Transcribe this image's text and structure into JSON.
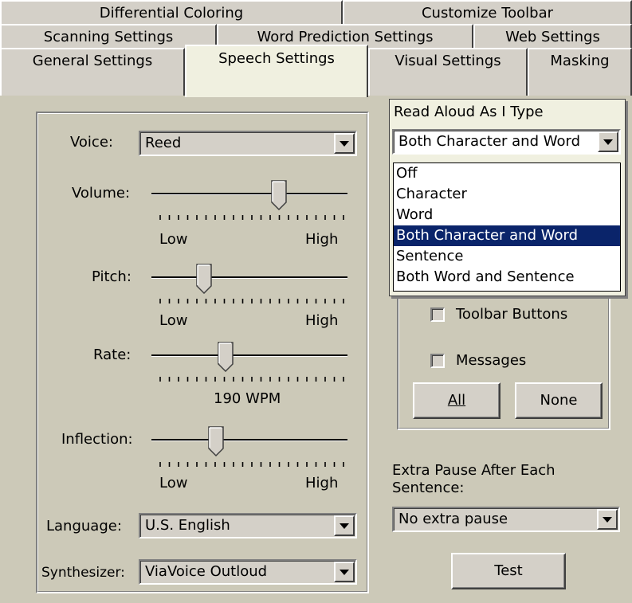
{
  "tabs": {
    "row1": [
      "Differential Coloring",
      "Customize Toolbar"
    ],
    "row2": [
      "Scanning Settings",
      "Word Prediction Settings",
      "Web Settings"
    ],
    "row3": [
      "General Settings",
      "Speech Settings",
      "Visual Settings",
      "Masking"
    ],
    "active": "Speech Settings"
  },
  "left": {
    "voice_label": "Voice:",
    "voice_value": "Reed",
    "volume_label": "Volume:",
    "volume_low": "Low",
    "volume_high": "High",
    "pitch_label": "Pitch:",
    "pitch_low": "Low",
    "pitch_high": "High",
    "rate_label": "Rate:",
    "rate_value": "190 WPM",
    "inflection_label": "Inflection:",
    "inflection_low": "Low",
    "inflection_high": "High",
    "language_label": "Language:",
    "language_value": "U.S. English",
    "synthesizer_label": "Synthesizer:",
    "synthesizer_value": "ViaVoice Outloud",
    "slider_levels": {
      "volume": 0.65,
      "pitch": 0.27,
      "rate": 0.38,
      "inflection": 0.33
    }
  },
  "right": {
    "read_aloud_label": "Read Aloud As I Type",
    "read_aloud_value": "Both Character and Word",
    "dropdown_options": [
      "Off",
      "Character",
      "Word",
      "Both Character and Word",
      "Sentence",
      "Both Word and Sentence"
    ],
    "dropdown_selected_index": 3,
    "toolbar_buttons_label": "Toolbar Buttons",
    "messages_label": "Messages",
    "all_button": "All",
    "none_button": "None",
    "extra_pause_label_line1": "Extra Pause After Each",
    "extra_pause_label_line2": "Sentence:",
    "extra_pause_value": "No extra pause",
    "test_button": "Test"
  }
}
